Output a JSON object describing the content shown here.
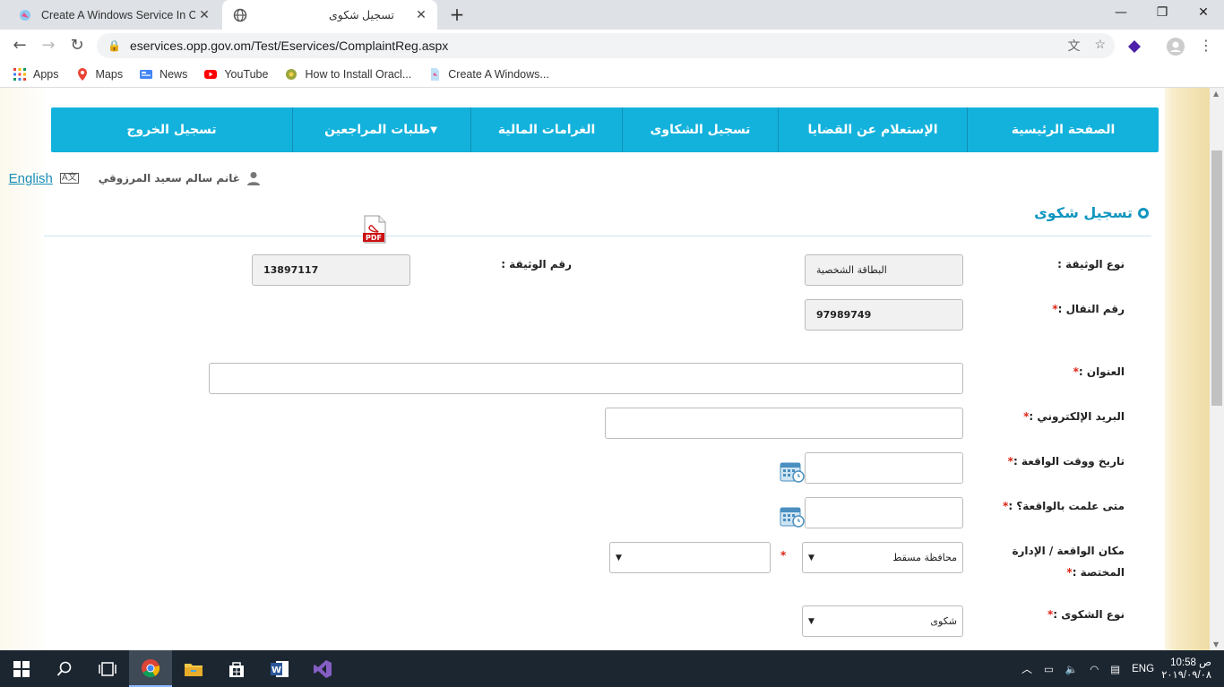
{
  "browser": {
    "tabs": [
      {
        "title": "Create A Windows Service In C#"
      },
      {
        "title": "تسجيل شكوى"
      }
    ],
    "url": "eservices.opp.gov.om/Test/Eservices/ComplaintReg.aspx",
    "bookmarks": [
      {
        "label": "Apps",
        "icon": "apps-grid-icon"
      },
      {
        "label": "Maps",
        "icon": "maps-icon"
      },
      {
        "label": "News",
        "icon": "news-icon"
      },
      {
        "label": "YouTube",
        "icon": "youtube-icon"
      },
      {
        "label": "How to Install Oracl...",
        "icon": "oracle-icon"
      },
      {
        "label": "Create A Windows...",
        "icon": "page-icon"
      }
    ]
  },
  "nav": {
    "items": [
      {
        "label": "الصفحة الرئيسية"
      },
      {
        "label": "الإستعلام عن القضايا"
      },
      {
        "label": "تسجيل الشكاوى"
      },
      {
        "label": "الغرامات المالية"
      },
      {
        "label": "طلبات المراجعين"
      },
      {
        "label": "تسجيل الخروج"
      }
    ]
  },
  "user": {
    "name": "غانم سالم سعيد المرزوقي",
    "language_link": "English"
  },
  "page": {
    "title": "تسجيل شكوى"
  },
  "form": {
    "doc_type_label": "نوع الوثيقة :",
    "doc_type_value": "البطاقة الشخصية",
    "doc_number_label": "رقم الوثيقة :",
    "doc_number_value": "13897117",
    "mobile_label": "رقم النقال :",
    "mobile_value": "97989749",
    "address_label": "العنوان :",
    "address_value": "",
    "email_label": "البريد الإلكتروني :",
    "email_value": "",
    "incident_datetime_label": "تاريخ ووقت الواقعة :",
    "incident_datetime_value": "",
    "known_when_label": "متى علمت بالواقعة؟ :",
    "known_when_value": "",
    "location_label_1": "مكان الواقعة / الإدارة",
    "location_label_2": "المختصة :",
    "governorate_value": "محافظة مسقط",
    "department_value": "",
    "complaint_type_label": "نوع الشكوى :",
    "complaint_type_value": "شكوى",
    "required_mark": "*",
    "pdf_label": "PDF"
  },
  "taskbar": {
    "time": "10:58",
    "ampm": "ص",
    "date": "٢٠١٩/٠٩/٠٨",
    "lang": "ENG"
  },
  "colors": {
    "nav_bg": "#13b2dc",
    "title": "#1196c0",
    "required": "#dd2211"
  }
}
